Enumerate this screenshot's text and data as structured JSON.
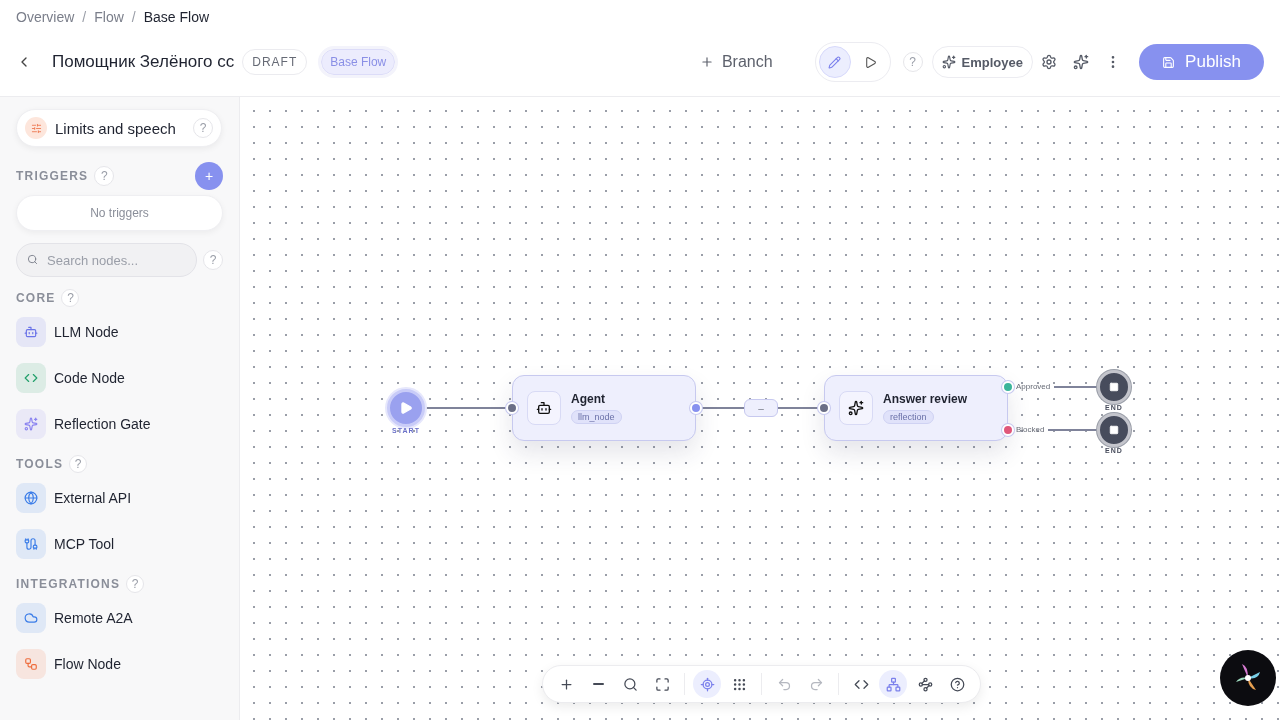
{
  "breadcrumb": {
    "separator": "/",
    "items": [
      {
        "label": "Overview",
        "current": false
      },
      {
        "label": "Flow",
        "current": false
      },
      {
        "label": "Base Flow",
        "current": true
      }
    ]
  },
  "header": {
    "title": "Помощник Зелёного сс",
    "status": "DRAFT",
    "flow_badge": "Base Flow",
    "branch": "Branch",
    "modes": [
      {
        "selected": true
      },
      {
        "selected": false
      }
    ],
    "help": "?",
    "employee": "Employee",
    "publish": "Publish"
  },
  "sidebar": {
    "limits": {
      "label": "Limits and speech",
      "help": "?"
    },
    "triggers": {
      "title": "TRIGGERS",
      "help": "?",
      "add": "+",
      "empty": "No triggers"
    },
    "search": {
      "placeholder": "Search nodes...",
      "help": "?"
    },
    "sections": [
      {
        "title": "CORE",
        "help": "?",
        "items": [
          {
            "label": "LLM Node",
            "color": "#6b74e8"
          },
          {
            "label": "Code Node",
            "color": "#22a06b"
          },
          {
            "label": "Reflection Gate",
            "color": "#8b84f0"
          }
        ]
      },
      {
        "title": "TOOLS",
        "help": "?",
        "items": [
          {
            "label": "External API",
            "color": "#3b7de8"
          },
          {
            "label": "MCP Tool",
            "color": "#3b7de8"
          }
        ]
      },
      {
        "title": "INTEGRATIONS",
        "help": "?",
        "items": [
          {
            "label": "Remote A2A",
            "color": "#3b7de8"
          },
          {
            "label": "Flow Node",
            "color": "#ee6c3c"
          }
        ]
      }
    ]
  },
  "canvas": {
    "start": {
      "label": "START"
    },
    "nodes": [
      {
        "title": "Agent",
        "tag": "llm_node"
      },
      {
        "title": "Answer review",
        "tag": "reflection",
        "outputs": [
          {
            "label": "Approved",
            "color": "#3bb59a"
          },
          {
            "label": "Blocked",
            "color": "#e0577a"
          }
        ]
      }
    ],
    "edge_label": "–",
    "ends": [
      {
        "label": "END"
      },
      {
        "label": "END"
      }
    ]
  },
  "toolbar": [
    {
      "selected": false,
      "disabled": false
    },
    {
      "selected": false,
      "disabled": false
    },
    {
      "selected": false,
      "disabled": false
    },
    {
      "selected": false,
      "disabled": false
    },
    {
      "selected": true,
      "disabled": false
    },
    {
      "selected": false,
      "disabled": false
    },
    {
      "selected": false,
      "disabled": true
    },
    {
      "selected": false,
      "disabled": true
    },
    {
      "selected": false,
      "disabled": false
    },
    {
      "selected": true,
      "disabled": false
    },
    {
      "selected": false,
      "disabled": false
    },
    {
      "selected": false,
      "disabled": false
    }
  ]
}
